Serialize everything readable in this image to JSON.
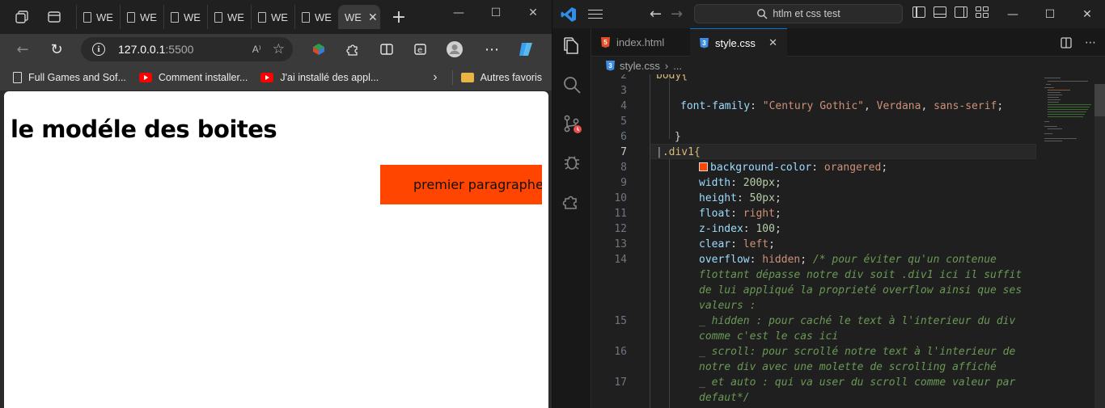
{
  "browser": {
    "tabs": [
      {
        "label": "WE",
        "icon": "document-icon"
      },
      {
        "label": "WE",
        "icon": "document-icon"
      },
      {
        "label": "WE",
        "icon": "document-icon"
      },
      {
        "label": "WE",
        "icon": "document-icon"
      },
      {
        "label": "WE",
        "icon": "document-icon"
      },
      {
        "label": "WE",
        "icon": "document-icon"
      }
    ],
    "active_tab": {
      "label": "WE",
      "close": "✕"
    },
    "new_tab": "+",
    "url": {
      "host": "127.0.0.1",
      "port": ":5500"
    },
    "read_aloud": "A⁾",
    "bookmarks": [
      {
        "label": "Full Games and Sof...",
        "icon": "page"
      },
      {
        "label": "Comment installer...",
        "icon": "youtube"
      },
      {
        "label": "J'ai installé des appl...",
        "icon": "youtube"
      }
    ],
    "other_favorites": "Autres favoris",
    "page": {
      "heading": "le modéle des boites",
      "paragraph": "premier paragraphe",
      "box_color": "#ff4500"
    }
  },
  "vscode": {
    "search_text": "htlm et css test",
    "tabs": [
      {
        "label": "index.html",
        "type": "html"
      },
      {
        "label": "style.css",
        "type": "css",
        "close": "✕"
      }
    ],
    "breadcrumb": {
      "file": "style.css",
      "more": "..."
    },
    "editor": {
      "lines": [
        {
          "n": "2",
          "text": "body{"
        },
        {
          "n": "3",
          "text": ""
        },
        {
          "n": "4",
          "text": "font-family: \"Century Gothic\", Verdana, sans-serif;"
        },
        {
          "n": "5",
          "text": ""
        },
        {
          "n": "6",
          "text": "}"
        },
        {
          "n": "7",
          "text": ".div1{"
        },
        {
          "n": "8",
          "text": "background-color: orangered;"
        },
        {
          "n": "9",
          "text": "width: 200px;"
        },
        {
          "n": "10",
          "text": "height: 50px;"
        },
        {
          "n": "11",
          "text": "float: right;"
        },
        {
          "n": "12",
          "text": "z-index: 100;"
        },
        {
          "n": "13",
          "text": "clear: left;"
        },
        {
          "n": "14",
          "text": "overflow: hidden;"
        },
        {
          "n": "15",
          "text": ""
        },
        {
          "n": "16",
          "text": ""
        },
        {
          "n": "17",
          "text": ""
        }
      ],
      "comment": [
        "/* pour éviter qu'un contenue",
        "flottant dépasse notre div soit .div1 ici il suffit",
        "de lui appliqué la proprieté overflow ainsi que ses",
        "valeurs :",
        "_ hidden : pour caché le text à l'interieur du div",
        "comme c'est le cas ici",
        "_ scroll: pour scrollé notre text à l'interieur de",
        "notre div avec une molette de scrolling affiché",
        "_ et auto : qui va user du scroll comme valeur par",
        "defaut*/"
      ]
    }
  }
}
